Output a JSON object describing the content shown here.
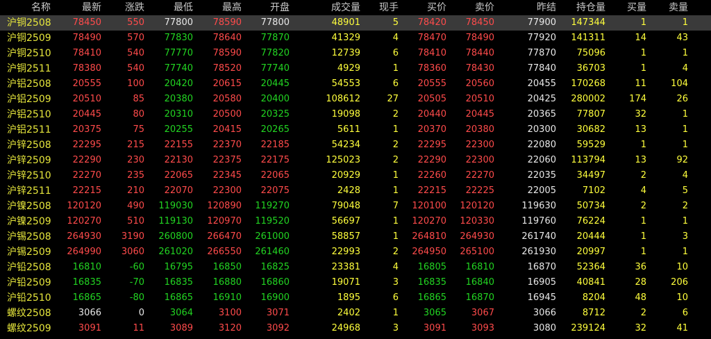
{
  "colors": {
    "up": "#ff4b4b",
    "down": "#22d522",
    "flat": "#e8e8e8",
    "volume": "#ffff3c",
    "name": "#e6e63c",
    "selected_row_bg": "#3a3a3a"
  },
  "headers": [
    "名称",
    "最新",
    "涨跌",
    "最低",
    "最高",
    "开盘",
    "成交量",
    "现手",
    "买价",
    "卖价",
    "昨结",
    "持仓量",
    "买量",
    "卖量"
  ],
  "selected_row": 0,
  "rows": [
    {
      "name": "沪铜2508",
      "last": "78450",
      "chg": "550",
      "low": "77800",
      "high": "78590",
      "open": "77800",
      "vol": "48901",
      "cur": "5",
      "bid": "78420",
      "ask": "78450",
      "prev": "77900",
      "oi": "147344",
      "bidv": "1",
      "askv": "1",
      "dir": "up",
      "low_dir": "flat",
      "high_dir": "up",
      "open_dir": "flat",
      "bid_dir": "up",
      "ask_dir": "up"
    },
    {
      "name": "沪铜2509",
      "last": "78490",
      "chg": "570",
      "low": "77830",
      "high": "78640",
      "open": "77870",
      "vol": "41329",
      "cur": "4",
      "bid": "78470",
      "ask": "78490",
      "prev": "77920",
      "oi": "141311",
      "bidv": "14",
      "askv": "43",
      "dir": "up",
      "low_dir": "down",
      "high_dir": "up",
      "open_dir": "down",
      "bid_dir": "up",
      "ask_dir": "up"
    },
    {
      "name": "沪铜2510",
      "last": "78410",
      "chg": "540",
      "low": "77770",
      "high": "78590",
      "open": "77820",
      "vol": "12739",
      "cur": "6",
      "bid": "78410",
      "ask": "78440",
      "prev": "77870",
      "oi": "75096",
      "bidv": "1",
      "askv": "1",
      "dir": "up",
      "low_dir": "down",
      "high_dir": "up",
      "open_dir": "down",
      "bid_dir": "up",
      "ask_dir": "up"
    },
    {
      "name": "沪铜2511",
      "last": "78380",
      "chg": "540",
      "low": "77740",
      "high": "78520",
      "open": "77740",
      "vol": "4929",
      "cur": "1",
      "bid": "78360",
      "ask": "78430",
      "prev": "77840",
      "oi": "36703",
      "bidv": "1",
      "askv": "4",
      "dir": "up",
      "low_dir": "down",
      "high_dir": "up",
      "open_dir": "down",
      "bid_dir": "up",
      "ask_dir": "up"
    },
    {
      "name": "沪铝2508",
      "last": "20555",
      "chg": "100",
      "low": "20420",
      "high": "20615",
      "open": "20445",
      "vol": "54553",
      "cur": "6",
      "bid": "20555",
      "ask": "20560",
      "prev": "20455",
      "oi": "170268",
      "bidv": "11",
      "askv": "104",
      "dir": "up",
      "low_dir": "down",
      "high_dir": "up",
      "open_dir": "down",
      "bid_dir": "up",
      "ask_dir": "up"
    },
    {
      "name": "沪铝2509",
      "last": "20510",
      "chg": "85",
      "low": "20380",
      "high": "20580",
      "open": "20400",
      "vol": "108612",
      "cur": "27",
      "bid": "20505",
      "ask": "20510",
      "prev": "20425",
      "oi": "280002",
      "bidv": "174",
      "askv": "26",
      "dir": "up",
      "low_dir": "down",
      "high_dir": "up",
      "open_dir": "down",
      "bid_dir": "up",
      "ask_dir": "up"
    },
    {
      "name": "沪铝2510",
      "last": "20445",
      "chg": "80",
      "low": "20310",
      "high": "20500",
      "open": "20325",
      "vol": "19098",
      "cur": "2",
      "bid": "20440",
      "ask": "20445",
      "prev": "20365",
      "oi": "77807",
      "bidv": "32",
      "askv": "1",
      "dir": "up",
      "low_dir": "down",
      "high_dir": "up",
      "open_dir": "down",
      "bid_dir": "up",
      "ask_dir": "up"
    },
    {
      "name": "沪铝2511",
      "last": "20375",
      "chg": "75",
      "low": "20255",
      "high": "20415",
      "open": "20265",
      "vol": "5611",
      "cur": "1",
      "bid": "20370",
      "ask": "20380",
      "prev": "20300",
      "oi": "30682",
      "bidv": "13",
      "askv": "1",
      "dir": "up",
      "low_dir": "down",
      "high_dir": "up",
      "open_dir": "down",
      "bid_dir": "up",
      "ask_dir": "up"
    },
    {
      "name": "沪锌2508",
      "last": "22295",
      "chg": "215",
      "low": "22155",
      "high": "22370",
      "open": "22185",
      "vol": "54234",
      "cur": "2",
      "bid": "22295",
      "ask": "22300",
      "prev": "22080",
      "oi": "59529",
      "bidv": "1",
      "askv": "1",
      "dir": "up",
      "low_dir": "up",
      "high_dir": "up",
      "open_dir": "up",
      "bid_dir": "up",
      "ask_dir": "up"
    },
    {
      "name": "沪锌2509",
      "last": "22290",
      "chg": "230",
      "low": "22130",
      "high": "22375",
      "open": "22175",
      "vol": "125023",
      "cur": "2",
      "bid": "22290",
      "ask": "22300",
      "prev": "22060",
      "oi": "113794",
      "bidv": "13",
      "askv": "92",
      "dir": "up",
      "low_dir": "up",
      "high_dir": "up",
      "open_dir": "up",
      "bid_dir": "up",
      "ask_dir": "up"
    },
    {
      "name": "沪锌2510",
      "last": "22270",
      "chg": "235",
      "low": "22065",
      "high": "22345",
      "open": "22065",
      "vol": "20929",
      "cur": "1",
      "bid": "22260",
      "ask": "22270",
      "prev": "22035",
      "oi": "34497",
      "bidv": "2",
      "askv": "4",
      "dir": "up",
      "low_dir": "up",
      "high_dir": "up",
      "open_dir": "up",
      "bid_dir": "up",
      "ask_dir": "up"
    },
    {
      "name": "沪锌2511",
      "last": "22215",
      "chg": "210",
      "low": "22070",
      "high": "22300",
      "open": "22075",
      "vol": "2428",
      "cur": "1",
      "bid": "22215",
      "ask": "22225",
      "prev": "22005",
      "oi": "7102",
      "bidv": "4",
      "askv": "5",
      "dir": "up",
      "low_dir": "up",
      "high_dir": "up",
      "open_dir": "up",
      "bid_dir": "up",
      "ask_dir": "up"
    },
    {
      "name": "沪镍2508",
      "last": "120120",
      "chg": "490",
      "low": "119030",
      "high": "120890",
      "open": "119270",
      "vol": "79048",
      "cur": "7",
      "bid": "120100",
      "ask": "120120",
      "prev": "119630",
      "oi": "50734",
      "bidv": "2",
      "askv": "2",
      "dir": "up",
      "low_dir": "down",
      "high_dir": "up",
      "open_dir": "down",
      "bid_dir": "up",
      "ask_dir": "up"
    },
    {
      "name": "沪镍2509",
      "last": "120270",
      "chg": "510",
      "low": "119130",
      "high": "120970",
      "open": "119520",
      "vol": "56697",
      "cur": "1",
      "bid": "120270",
      "ask": "120330",
      "prev": "119760",
      "oi": "76224",
      "bidv": "1",
      "askv": "1",
      "dir": "up",
      "low_dir": "down",
      "high_dir": "up",
      "open_dir": "down",
      "bid_dir": "up",
      "ask_dir": "up"
    },
    {
      "name": "沪锡2508",
      "last": "264930",
      "chg": "3190",
      "low": "260800",
      "high": "266470",
      "open": "261000",
      "vol": "58857",
      "cur": "1",
      "bid": "264810",
      "ask": "264930",
      "prev": "261740",
      "oi": "20444",
      "bidv": "1",
      "askv": "3",
      "dir": "up",
      "low_dir": "down",
      "high_dir": "up",
      "open_dir": "down",
      "bid_dir": "up",
      "ask_dir": "up"
    },
    {
      "name": "沪锡2509",
      "last": "264990",
      "chg": "3060",
      "low": "261020",
      "high": "266550",
      "open": "261460",
      "vol": "22993",
      "cur": "2",
      "bid": "264950",
      "ask": "265100",
      "prev": "261930",
      "oi": "20997",
      "bidv": "1",
      "askv": "1",
      "dir": "up",
      "low_dir": "down",
      "high_dir": "up",
      "open_dir": "down",
      "bid_dir": "up",
      "ask_dir": "up"
    },
    {
      "name": "沪铅2508",
      "last": "16810",
      "chg": "-60",
      "low": "16795",
      "high": "16850",
      "open": "16825",
      "vol": "23381",
      "cur": "4",
      "bid": "16805",
      "ask": "16810",
      "prev": "16870",
      "oi": "52364",
      "bidv": "36",
      "askv": "10",
      "dir": "down",
      "low_dir": "down",
      "high_dir": "down",
      "open_dir": "down",
      "bid_dir": "down",
      "ask_dir": "down"
    },
    {
      "name": "沪铅2509",
      "last": "16835",
      "chg": "-70",
      "low": "16835",
      "high": "16880",
      "open": "16860",
      "vol": "19071",
      "cur": "3",
      "bid": "16835",
      "ask": "16840",
      "prev": "16905",
      "oi": "40841",
      "bidv": "28",
      "askv": "206",
      "dir": "down",
      "low_dir": "down",
      "high_dir": "down",
      "open_dir": "down",
      "bid_dir": "down",
      "ask_dir": "down"
    },
    {
      "name": "沪铅2510",
      "last": "16865",
      "chg": "-80",
      "low": "16865",
      "high": "16910",
      "open": "16900",
      "vol": "1895",
      "cur": "6",
      "bid": "16865",
      "ask": "16870",
      "prev": "16945",
      "oi": "8204",
      "bidv": "48",
      "askv": "10",
      "dir": "down",
      "low_dir": "down",
      "high_dir": "down",
      "open_dir": "down",
      "bid_dir": "down",
      "ask_dir": "down"
    },
    {
      "name": "螺纹2508",
      "last": "3066",
      "chg": "0",
      "low": "3064",
      "high": "3100",
      "open": "3071",
      "vol": "2402",
      "cur": "1",
      "bid": "3065",
      "ask": "3067",
      "prev": "3066",
      "oi": "8712",
      "bidv": "2",
      "askv": "6",
      "dir": "flat",
      "low_dir": "down",
      "high_dir": "up",
      "open_dir": "up",
      "bid_dir": "down",
      "ask_dir": "up"
    },
    {
      "name": "螺纹2509",
      "last": "3091",
      "chg": "11",
      "low": "3089",
      "high": "3120",
      "open": "3092",
      "vol": "24968",
      "cur": "3",
      "bid": "3091",
      "ask": "3093",
      "prev": "3080",
      "oi": "239124",
      "bidv": "32",
      "askv": "41",
      "dir": "up",
      "low_dir": "up",
      "high_dir": "up",
      "open_dir": "up",
      "bid_dir": "up",
      "ask_dir": "up"
    }
  ]
}
